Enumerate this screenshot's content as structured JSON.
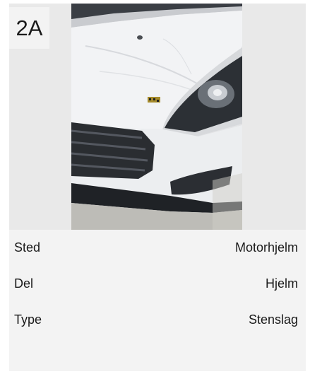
{
  "damage": {
    "id": "2A",
    "photo_alt": "Skadebilde",
    "fields": [
      {
        "label": "Sted",
        "value": "Motorhjelm"
      },
      {
        "label": "Del",
        "value": "Hjelm"
      },
      {
        "label": "Type",
        "value": "Stenslag"
      }
    ]
  }
}
